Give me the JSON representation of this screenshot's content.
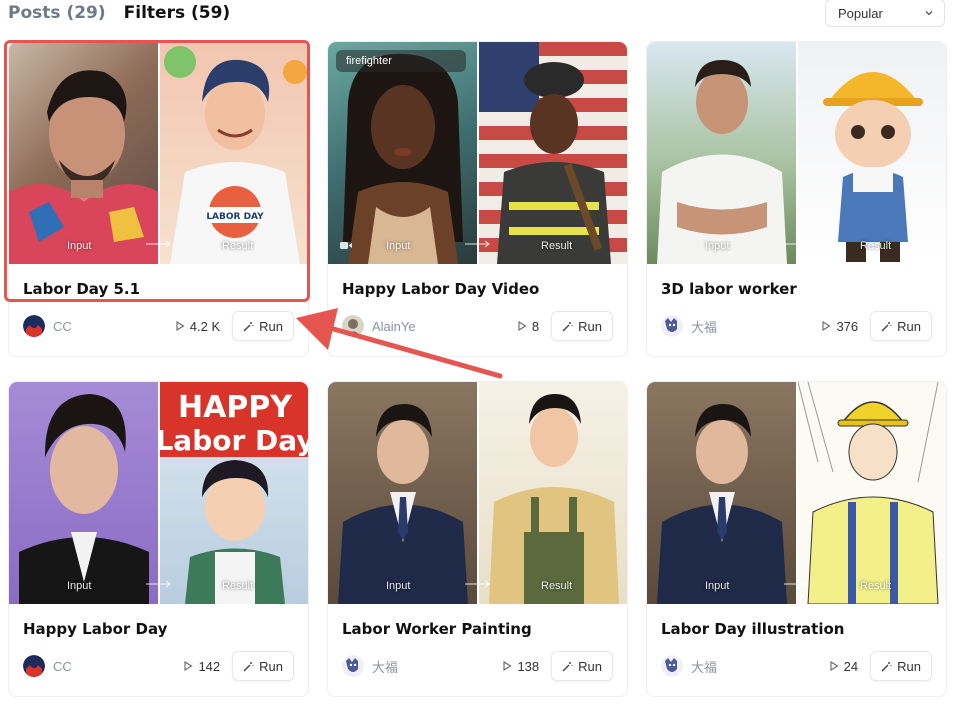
{
  "header": {
    "tabs": [
      {
        "label": "Posts",
        "count": "(29)"
      },
      {
        "label": "Filters",
        "count": "(59)"
      }
    ],
    "sort": {
      "value": "Popular"
    }
  },
  "cards": [
    {
      "title": "Labor Day 5.1",
      "author": "CC",
      "plays": "4.2 K",
      "run_label": "Run",
      "input_label": "Input",
      "result_label": "Result",
      "tag": "",
      "has_video": false
    },
    {
      "title": "Happy Labor Day Video",
      "author": "AlainYe",
      "plays": "8",
      "run_label": "Run",
      "input_label": "Input",
      "result_label": "Result",
      "tag": "firefighter",
      "has_video": true
    },
    {
      "title": "3D labor worker",
      "author": "大福",
      "plays": "376",
      "run_label": "Run",
      "input_label": "Input",
      "result_label": "Result",
      "tag": "",
      "has_video": false
    },
    {
      "title": "Happy Labor Day",
      "author": "CC",
      "plays": "142",
      "run_label": "Run",
      "input_label": "Input",
      "result_label": "Result",
      "tag": "",
      "has_video": false
    },
    {
      "title": "Labor Worker Painting",
      "author": "大福",
      "plays": "138",
      "run_label": "Run",
      "input_label": "Input",
      "result_label": "Result",
      "tag": "",
      "has_video": false
    },
    {
      "title": "Labor Day illustration",
      "author": "大福",
      "plays": "24",
      "run_label": "Run",
      "input_label": "Input",
      "result_label": "Result",
      "tag": "",
      "has_video": false
    }
  ],
  "thumb_text": {
    "labor_day_sign": "LABOR DAY",
    "happy_banner_line1": "HAPPY",
    "happy_banner_line2": "Labor Day"
  },
  "colors": {
    "highlight": "#e4564f",
    "muted_text": "#8a93a0",
    "border": "#edeff2"
  }
}
